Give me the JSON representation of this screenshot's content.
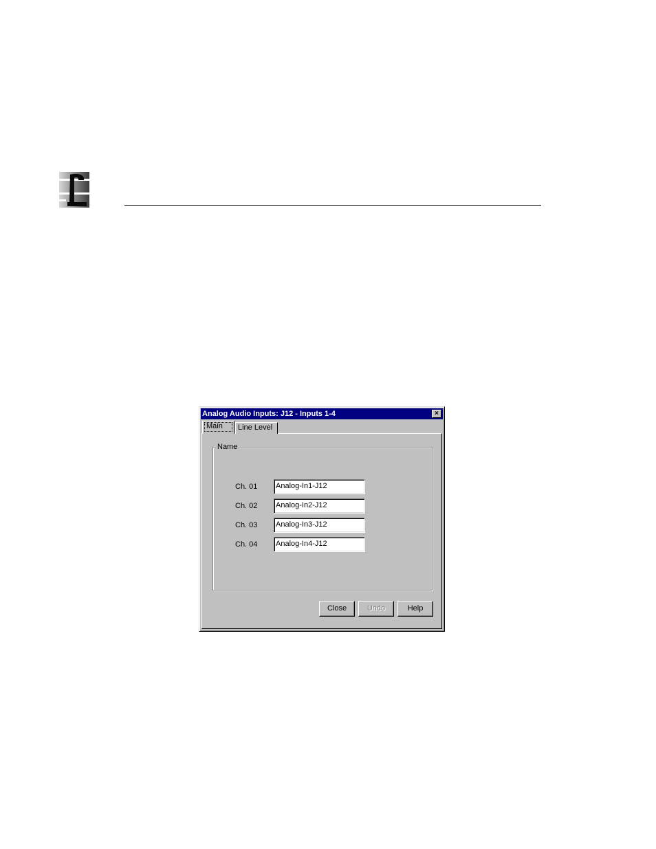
{
  "header": {
    "logo_icon": "company-logo-icon"
  },
  "dialog": {
    "title": "Analog Audio Inputs: J12 - Inputs 1-4",
    "close_glyph": "×",
    "tabs": [
      {
        "label": "Main",
        "selected": true
      },
      {
        "label": "Line Level",
        "selected": false
      }
    ],
    "group_label": "Name",
    "channels": [
      {
        "label": "Ch. 01",
        "value": "Analog-In1-J12"
      },
      {
        "label": "Ch. 02",
        "value": "Analog-In2-J12"
      },
      {
        "label": "Ch. 03",
        "value": "Analog-In3-J12"
      },
      {
        "label": "Ch. 04",
        "value": "Analog-In4-J12"
      }
    ],
    "buttons": {
      "close": "Close",
      "undo": "Undo",
      "help": "Help"
    },
    "colors": {
      "titlebar": "#000080",
      "face": "#c0c0c0"
    }
  }
}
